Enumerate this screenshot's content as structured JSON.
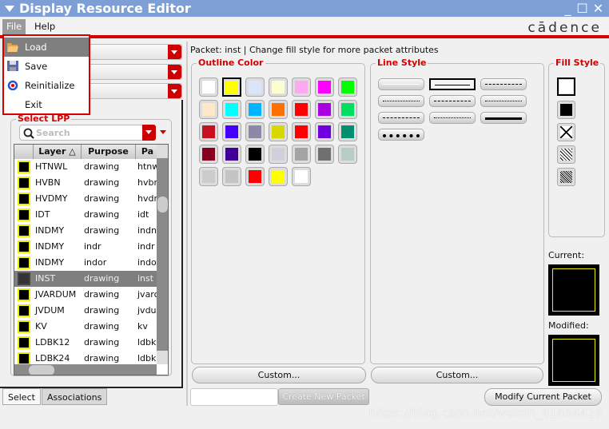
{
  "window": {
    "title": "Display Resource Editor",
    "minimize": "_",
    "maximize": "☐",
    "close": "✕"
  },
  "menubar": {
    "file": "File",
    "help": "Help",
    "logo": "cādence"
  },
  "file_menu": [
    {
      "label": "Load",
      "icon": "folder-open-icon"
    },
    {
      "label": "Save",
      "icon": "floppy-disk-icon"
    },
    {
      "label": "Reinitialize",
      "icon": "reinitialize-icon"
    },
    {
      "label": "Exit",
      "icon": ""
    }
  ],
  "select_lpp": {
    "title": "Select LPP",
    "search_placeholder": "Search",
    "columns": [
      "",
      "Layer",
      "Purpose",
      "Pa"
    ],
    "rows": [
      {
        "layer": "HTNWL",
        "purpose": "drawing",
        "packet": "htnw"
      },
      {
        "layer": "HVBN",
        "purpose": "drawing",
        "packet": "hvbn"
      },
      {
        "layer": "HVDMY",
        "purpose": "drawing",
        "packet": "hvdr"
      },
      {
        "layer": "IDT",
        "purpose": "drawing",
        "packet": "idt"
      },
      {
        "layer": "INDMY",
        "purpose": "drawing",
        "packet": "indn"
      },
      {
        "layer": "INDMY",
        "purpose": "indr",
        "packet": "indr"
      },
      {
        "layer": "INDMY",
        "purpose": "indor",
        "packet": "indo"
      },
      {
        "layer": "INST",
        "purpose": "drawing",
        "packet": "inst",
        "selected": true
      },
      {
        "layer": "JVARDUM",
        "purpose": "drawing",
        "packet": "jvarc"
      },
      {
        "layer": "JVDUM",
        "purpose": "drawing",
        "packet": "jvdu"
      },
      {
        "layer": "KV",
        "purpose": "drawing",
        "packet": "kv"
      },
      {
        "layer": "LDBK12",
        "purpose": "drawing",
        "packet": "ldbk"
      },
      {
        "layer": "LDBK24",
        "purpose": "drawing",
        "packet": "ldbk"
      }
    ]
  },
  "tabs": [
    "Select",
    "Associations"
  ],
  "packet_info": "Packet: inst | Change fill style for more packet attributes",
  "outline_color": {
    "title": "Outline Color",
    "selected": "#ffff00",
    "colors": [
      "#ffffff",
      "#ffff00",
      "#dae4fa",
      "#fcfdd0",
      "#fcaaf0",
      "#ff00ff",
      "#00ff00",
      "#fee8c8",
      "#00ffff",
      "#00b4ff",
      "#ff7000",
      "#ff0000",
      "#a800e0",
      "#00e060",
      "#c8101e",
      "#4400ff",
      "#8c88a8",
      "#d8d800",
      "#ff0000",
      "#7000e0",
      "#009070",
      "#880020",
      "#400098",
      "#000000",
      "#d0d0dc",
      "#a4a4a4",
      "#707070",
      "#b8ccc8",
      "#cccccc",
      "#c4c4c4",
      "#ff0000",
      "#ffff00",
      "#ffffff"
    ],
    "custom": "Custom..."
  },
  "line_style": {
    "title": "Line Style",
    "styles": [
      "solid-thin",
      "solid-box",
      "dashed",
      "dotted",
      "dash-dot",
      "dotted-fine",
      "dash-dot-dot",
      "dotted-sparse",
      "thick",
      "thick-dashed"
    ],
    "selected": "solid-box",
    "custom": "Custom..."
  },
  "fill_style": {
    "title": "Fill Style",
    "styles": [
      "outline",
      "solid",
      "x",
      "hatch-sparse",
      "hatch-dense"
    ],
    "selected": "outline"
  },
  "preview": {
    "current_label": "Current:",
    "modified_label": "Modified:",
    "fill": "#000000",
    "outline": "#ffff00"
  },
  "bottom": {
    "packet_name": "",
    "create": "Create New Packet",
    "modify": "Modify Current Packet"
  },
  "watermark": "https://blog.csdn.net/weixin_41464428"
}
